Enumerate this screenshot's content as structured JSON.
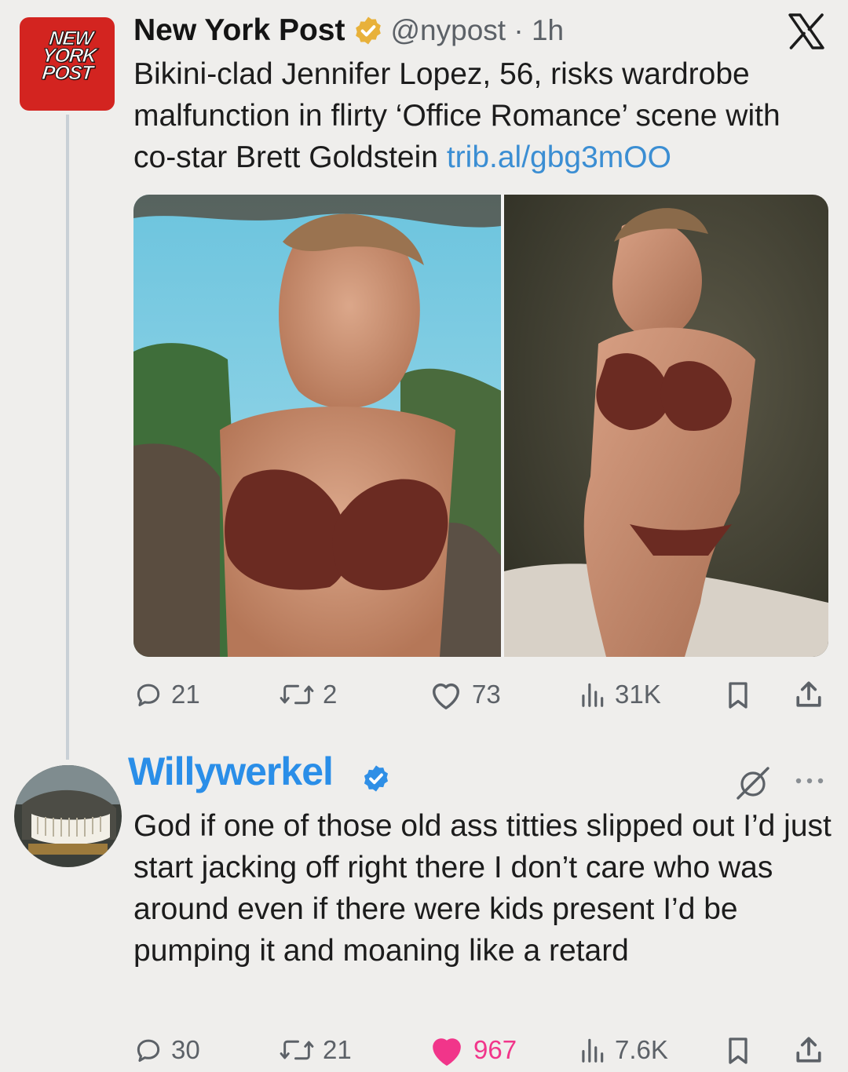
{
  "tweet": {
    "logo_lines": [
      "NEW",
      "YORK",
      "POST"
    ],
    "author_name": "New York Post",
    "handle_time": "@nypost · 1h",
    "text": "Bikini-clad Jennifer Lopez, 56, risks wardrobe malfunction in flirty ‘Office Romance’ scene with co-star Brett Goldstein ",
    "link": "trib.al/gbg3mOO",
    "stats": {
      "replies": "21",
      "reposts": "2",
      "likes": "73",
      "views": "31K"
    }
  },
  "reply": {
    "author_name": "Willywerkel",
    "text": "God if one of those old ass titties slipped out I’d just start jacking off right there I don’t care who was around even if there were kids present I’d be pumping it and moaning like a retard",
    "stats": {
      "replies": "30",
      "reposts": "21",
      "likes": "967",
      "views": "7.6K"
    },
    "liked": true
  },
  "colors": {
    "background": "#efeeec",
    "link": "#3b8ed3",
    "verified_gold": "#e8b13a",
    "verified_blue": "#2f8fe6",
    "like_active": "#f1358a",
    "icon_gray": "#5c6167",
    "brand_red": "#d32420"
  },
  "icons": [
    "verified-gold-icon",
    "x-logo-icon",
    "reply-icon",
    "repost-icon",
    "heart-icon",
    "views-icon",
    "bookmark-icon",
    "share-icon",
    "verified-blue-icon",
    "grok-icon",
    "more-icon"
  ]
}
